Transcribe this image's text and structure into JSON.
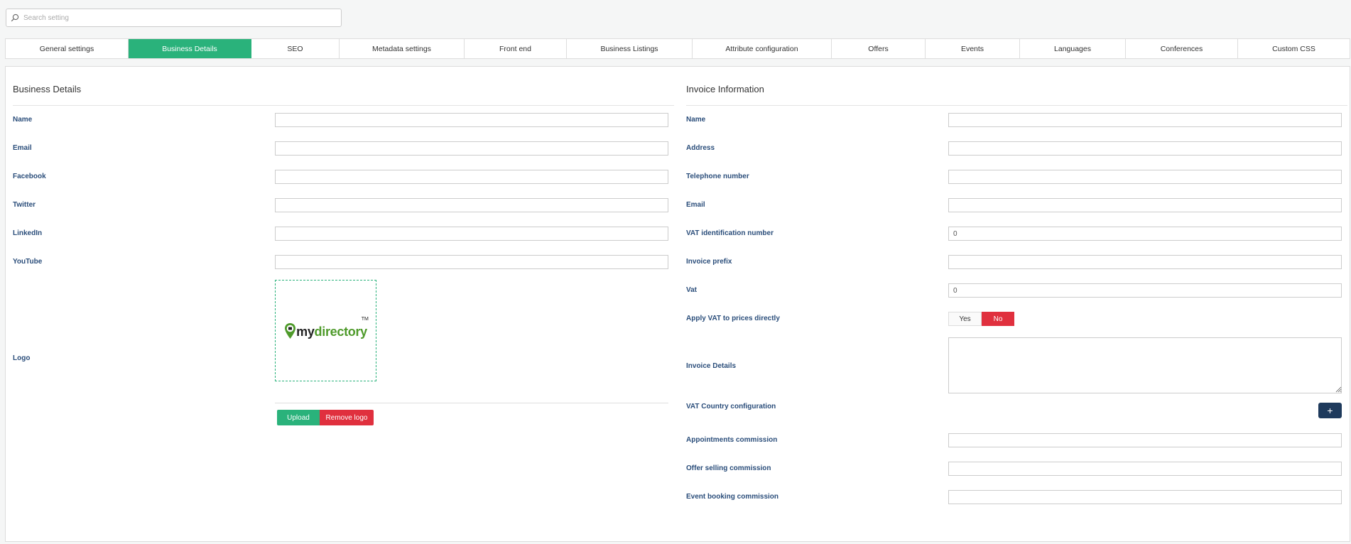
{
  "search": {
    "placeholder": "Search setting"
  },
  "tabs": [
    {
      "label": "General settings"
    },
    {
      "label": "Business Details",
      "active": true
    },
    {
      "label": "SEO"
    },
    {
      "label": "Metadata settings"
    },
    {
      "label": "Front end"
    },
    {
      "label": "Business Listings"
    },
    {
      "label": "Attribute configuration"
    },
    {
      "label": "Offers"
    },
    {
      "label": "Events"
    },
    {
      "label": "Languages"
    },
    {
      "label": "Conferences"
    },
    {
      "label": "Custom CSS"
    }
  ],
  "business": {
    "title": "Business Details",
    "fields": [
      {
        "label": "Name",
        "value": ""
      },
      {
        "label": "Email",
        "value": ""
      },
      {
        "label": "Facebook",
        "value": ""
      },
      {
        "label": "Twitter",
        "value": ""
      },
      {
        "label": "LinkedIn",
        "value": ""
      },
      {
        "label": "YouTube",
        "value": ""
      }
    ],
    "logo_label": "Logo",
    "logo": {
      "text_dark": "my",
      "text_green": "directory",
      "tm": "TM"
    },
    "upload_label": "Upload",
    "remove_label": "Remove logo"
  },
  "invoice": {
    "title": "Invoice Information",
    "fields": [
      {
        "label": "Name",
        "value": ""
      },
      {
        "label": "Address",
        "value": ""
      },
      {
        "label": "Telephone number",
        "value": ""
      },
      {
        "label": "Email",
        "value": ""
      },
      {
        "label": "VAT identification number",
        "value": "0"
      },
      {
        "label": "Invoice prefix",
        "value": ""
      },
      {
        "label": "Vat",
        "value": "0"
      }
    ],
    "apply_vat": {
      "label": "Apply VAT to prices directly",
      "yes": "Yes",
      "no": "No",
      "selected": "No"
    },
    "details": {
      "label": "Invoice Details",
      "value": ""
    },
    "vat_country": {
      "label": "VAT Country configuration",
      "add": "+"
    },
    "commissions": [
      {
        "label": "Appointments commission",
        "value": ""
      },
      {
        "label": "Offer selling commission",
        "value": ""
      },
      {
        "label": "Event booking commission",
        "value": ""
      }
    ]
  },
  "colors": {
    "accent": "#2ab27b",
    "danger": "#e0303e",
    "label": "#2a4d7a",
    "navy": "#1e3a5c"
  }
}
